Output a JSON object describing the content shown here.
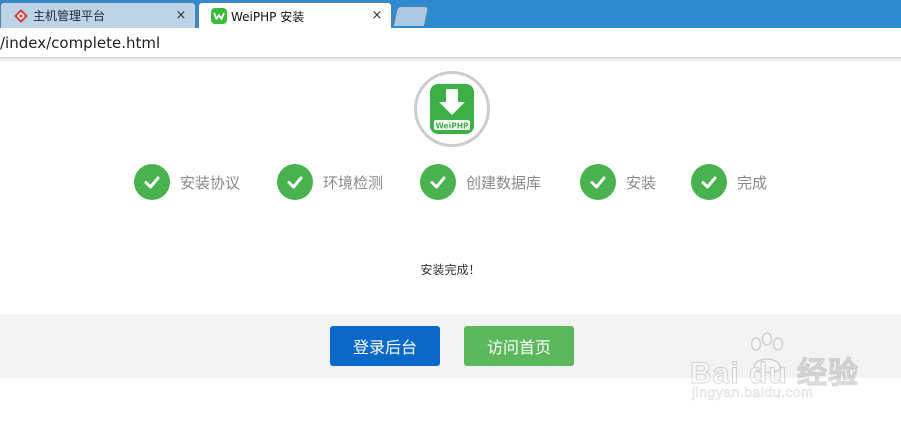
{
  "browser": {
    "tabs": [
      {
        "title": "主机管理平台",
        "active": false
      },
      {
        "title": "WeiPHP 安装",
        "active": true
      }
    ],
    "close_symbol": "×",
    "address": "/index/complete.html"
  },
  "installer": {
    "logo_text": "WeiPHP",
    "steps": [
      {
        "label": "安装协议",
        "icon": "check-icon",
        "done": true
      },
      {
        "label": "环境检测",
        "icon": "check-icon",
        "done": true
      },
      {
        "label": "创建数据库",
        "icon": "check-icon",
        "done": true
      },
      {
        "label": "安装",
        "icon": "check-icon",
        "done": true
      },
      {
        "label": "完成",
        "icon": "check-icon",
        "done": true
      }
    ],
    "message": "安装完成！",
    "buttons": {
      "login": "登录后台",
      "home": "访问首页"
    }
  },
  "watermark": {
    "brand": "Bai du 经验",
    "url": "jingyan.baidu.com"
  },
  "colors": {
    "tab_strip": "#2f8bd0",
    "success_green": "#48b24e",
    "login_blue": "#0a68c8",
    "home_green": "#5cb85c",
    "footer_bg": "#f3f3f3"
  }
}
